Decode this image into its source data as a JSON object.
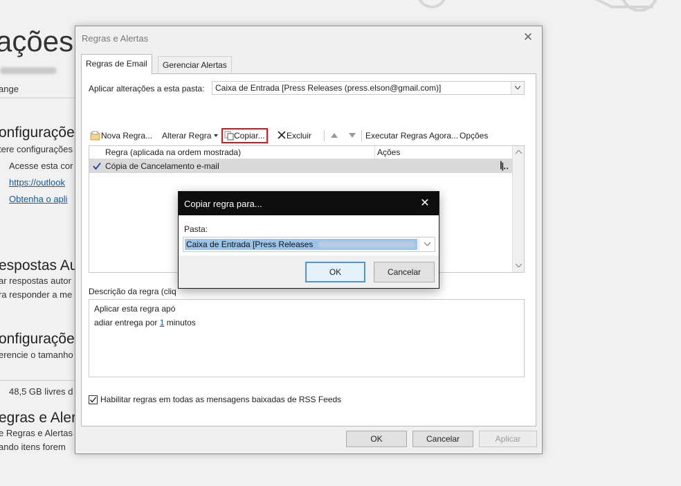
{
  "background": {
    "title": "ações",
    "account_line": "ange",
    "section1": {
      "heading": "onfiguraçõe",
      "sub": "tere configurações",
      "item1": "Acesse esta cor",
      "link1": "https://outlook",
      "link2": "Obtenha o apli"
    },
    "section2": {
      "heading": "espostas Au",
      "sub1": "ar respostas autor",
      "sub2": "ra responder a me"
    },
    "section3": {
      "heading": "onfiguraçõe",
      "sub": "erencie o tamanho",
      "storage": "48,5 GB livres d"
    },
    "section4": {
      "heading": "egras e Aler",
      "sub1": "e Regras e Alertas",
      "sub2": "ando itens forem"
    }
  },
  "dialog": {
    "title": "Regras e Alertas",
    "close": "✕",
    "tabs": [
      "Regras de Email",
      "Gerenciar Alertas"
    ],
    "apply_label": "Aplicar alterações a esta pasta:",
    "apply_folder": "Caixa de Entrada [Press Releases (press.elson@gmail.com)]",
    "toolbar": {
      "new_rule": "Nova Regra...",
      "change_rule": "Alterar Regra",
      "copy": "Copiar...",
      "delete": "Excluir",
      "run_rules": "Executar Regras Agora...",
      "options": "Opções"
    },
    "rules_table": {
      "col_rule": "Regra (aplicada na ordem mostrada)",
      "col_actions": "Ações",
      "rows": [
        {
          "name": "Cópia de Cancelamento e-mail",
          "checked": true
        }
      ]
    },
    "description_label": "Descrição da regra (cliq",
    "description": {
      "line1": "Aplicar esta regra apó",
      "line2_prefix": "adiar entrega por ",
      "line2_link": "1",
      "line2_suffix": " minutos"
    },
    "rss_label": "Habilitar regras em todas as mensagens baixadas de RSS Feeds",
    "buttons": {
      "ok": "OK",
      "cancel": "Cancelar",
      "apply": "Aplicar"
    }
  },
  "copy_dialog": {
    "title": "Copiar regra para...",
    "close": "✕",
    "folder_label": "Pasta:",
    "folder_value": "Caixa de Entrada [Press Releases",
    "ok": "OK",
    "cancel": "Cancelar"
  }
}
